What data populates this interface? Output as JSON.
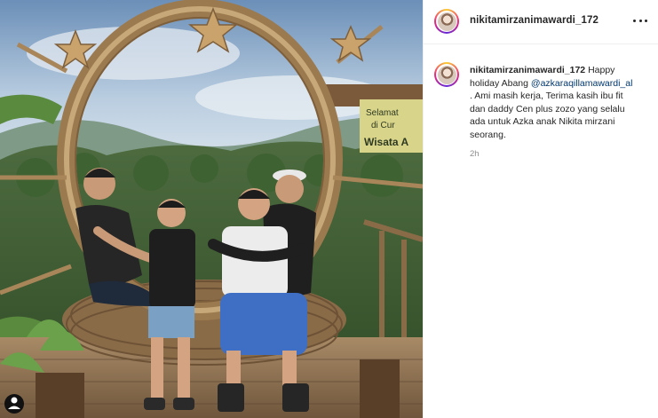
{
  "post": {
    "username": "nikitamirzanimawardi_172",
    "more_icon": "more-horizontal-icon",
    "caption": {
      "username": "nikitamirzanimawardi_172",
      "text_before": "Happy holiday Abang",
      "mention": "@azkaraqillamawardi_al",
      "text_after": ". Ami masih kerja, Terima kasih ibu fit dan daddy Cen plus zozo yang selalu ada untuk Azka anak Nikita mirzani seorang."
    },
    "time_ago": "2h"
  },
  "photo": {
    "sign_lines": [
      "Selamat",
      "di Cur",
      "Wisata A"
    ]
  },
  "colors": {
    "mention": "#00376b",
    "secondary_text": "#8e8e8e",
    "divider": "#efefef"
  }
}
